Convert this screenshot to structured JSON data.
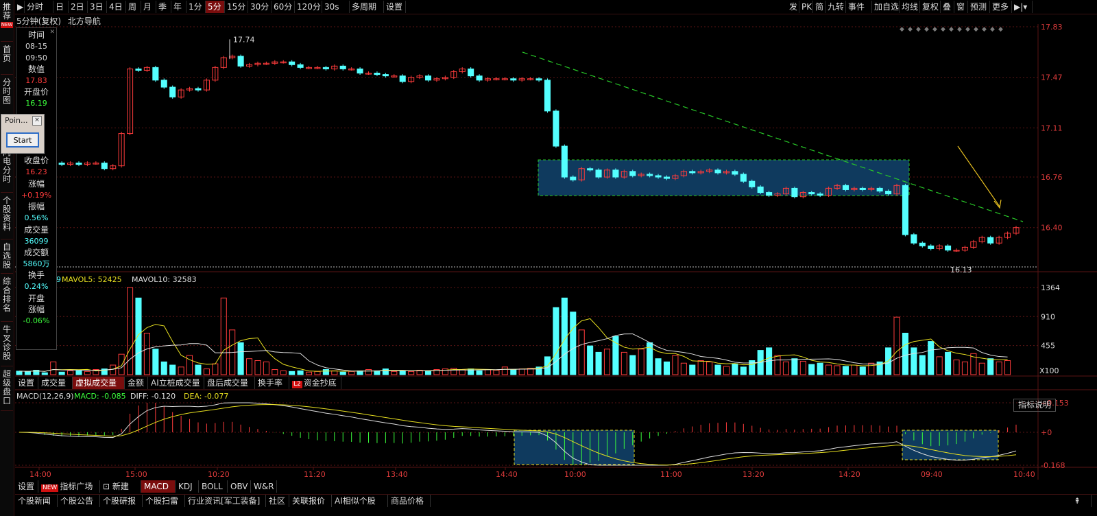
{
  "toolbar": {
    "items": [
      "分时",
      "日",
      "2日",
      "3日",
      "4日",
      "周",
      "月",
      "季",
      "年",
      "1分",
      "5分",
      "15分",
      "30分",
      "60分",
      "120分",
      "30s",
      "多周期",
      "设置"
    ],
    "active": "5分",
    "right_items": [
      "发",
      "PK",
      "简",
      "九转",
      "事件",
      "加自选",
      "均线",
      "复权",
      "叠",
      "窗",
      "预测",
      "更多"
    ]
  },
  "chart_header": {
    "period": "5分钟(复权)",
    "stock_name": "北方导航"
  },
  "left_nav": [
    {
      "text": "推荐",
      "badge": "NEW"
    },
    {
      "text": "首页"
    },
    {
      "text": "分时图"
    },
    {
      "text": "闪电分时"
    },
    {
      "text": "个股资料"
    },
    {
      "text": "自选股"
    },
    {
      "text": "综合排名"
    },
    {
      "text": "牛叉诊股"
    },
    {
      "text": "超级盘口"
    }
  ],
  "info_panel": {
    "time_label": "时间",
    "date": "08-15",
    "time": "09:50",
    "value_label": "数值",
    "value": "17.83",
    "open_label": "开盘价",
    "open": "16.19",
    "close_label": "收盘价",
    "close": "16.23",
    "chg_label": "涨幅",
    "chg": "+0.19%",
    "amp_label": "振幅",
    "amp": "0.56%",
    "vol_label": "成交量",
    "vol": "36099",
    "amt_label": "成交额",
    "amt": "5860万",
    "turn_label": "换手",
    "turn": "0.24%",
    "openchg_label1": "开盘",
    "openchg_label2": "涨幅",
    "openchg": "-0.06%"
  },
  "popup": {
    "title": "Poin...",
    "close": "×",
    "button": "Start"
  },
  "price_axis": [
    "17.83",
    "17.47",
    "17.11",
    "16.76",
    "16.40"
  ],
  "price_marks": {
    "high": "17.74",
    "low": "16.13"
  },
  "volume_header": {
    "mavol5_label": "MAVOL5: 52425",
    "mavol10_label": "MAVOL10: 32583",
    "prefix": "9"
  },
  "volume_axis": [
    "1364",
    "910",
    "455",
    "X100"
  ],
  "volume_tabs": [
    "设置",
    "成交量",
    "虚拟成交量",
    "金额",
    "AI立桩成交量",
    "盘后成交量",
    "换手率",
    "资金抄底"
  ],
  "volume_tab_active": "虚拟成交量",
  "volume_tab_badge": "L2",
  "macd_header": {
    "name": "MACD(12,26,9)",
    "macd": "MACD: -0.085",
    "diff": "DIFF: -0.120",
    "dea": "DEA: -0.077"
  },
  "macd_axis": [
    "+0.153",
    "+0",
    "-0.168"
  ],
  "macd_help": "指标说明",
  "time_axis": [
    "14:00",
    "15:00",
    "10:20",
    "11:20",
    "13:40",
    "14:40",
    "10:00",
    "11:00",
    "13:20",
    "14:20",
    "09:40",
    "10:40"
  ],
  "indicator_tabs": [
    "设置",
    "指标广场",
    "新建",
    "MACD",
    "KDJ",
    "BOLL",
    "OBV",
    "W&R"
  ],
  "indicator_tab_active": "MACD",
  "indicator_badge": "NEW",
  "bottom_tabs": [
    "个股新闻",
    "个股公告",
    "个股研报",
    "个股扫雷",
    "行业资讯[军工装备]",
    "社区",
    "关联报价",
    "AI相似个股",
    "商品价格"
  ],
  "colors": {
    "up": "#ff3c3c",
    "down": "#54ffff",
    "bg": "#000000",
    "grid": "#5a1414",
    "axis_text": "#e03c3c",
    "highlight": "#0f3a5e",
    "trend": "#28c828"
  },
  "chart_data": {
    "type": "candlestick",
    "price_range": [
      16.13,
      17.83
    ],
    "high": 17.74,
    "low": 16.13,
    "candles": [
      [
        16.95,
        16.94
      ],
      [
        16.94,
        16.93
      ],
      [
        16.93,
        16.9
      ],
      [
        16.9,
        16.86
      ],
      [
        16.86,
        16.86
      ],
      [
        16.86,
        16.85
      ],
      [
        16.85,
        16.86
      ],
      [
        16.86,
        16.85
      ],
      [
        16.85,
        16.86
      ],
      [
        16.86,
        16.86
      ],
      [
        16.86,
        16.82
      ],
      [
        16.82,
        16.84
      ],
      [
        16.84,
        17.07
      ],
      [
        17.07,
        17.53
      ],
      [
        17.53,
        17.52
      ],
      [
        17.52,
        17.54
      ],
      [
        17.54,
        17.45
      ],
      [
        17.45,
        17.4
      ],
      [
        17.4,
        17.33
      ],
      [
        17.33,
        17.38
      ],
      [
        17.38,
        17.39
      ],
      [
        17.39,
        17.38
      ],
      [
        17.38,
        17.45
      ],
      [
        17.45,
        17.54
      ],
      [
        17.54,
        17.61
      ],
      [
        17.61,
        17.62
      ],
      [
        17.62,
        17.55
      ],
      [
        17.55,
        17.56
      ],
      [
        17.56,
        17.57
      ],
      [
        17.57,
        17.57
      ],
      [
        17.57,
        17.58
      ],
      [
        17.58,
        17.58
      ],
      [
        17.58,
        17.56
      ],
      [
        17.56,
        17.54
      ],
      [
        17.54,
        17.54
      ],
      [
        17.54,
        17.54
      ],
      [
        17.54,
        17.53
      ],
      [
        17.53,
        17.55
      ],
      [
        17.55,
        17.53
      ],
      [
        17.53,
        17.53
      ],
      [
        17.53,
        17.5
      ],
      [
        17.5,
        17.5
      ],
      [
        17.5,
        17.49
      ],
      [
        17.49,
        17.48
      ],
      [
        17.48,
        17.48
      ],
      [
        17.48,
        17.44
      ],
      [
        17.44,
        17.47
      ],
      [
        17.47,
        17.48
      ],
      [
        17.48,
        17.45
      ],
      [
        17.45,
        17.46
      ],
      [
        17.46,
        17.47
      ],
      [
        17.47,
        17.51
      ],
      [
        17.51,
        17.53
      ],
      [
        17.53,
        17.48
      ],
      [
        17.48,
        17.45
      ],
      [
        17.45,
        17.46
      ],
      [
        17.46,
        17.46
      ],
      [
        17.46,
        17.46
      ],
      [
        17.46,
        17.45
      ],
      [
        17.45,
        17.46
      ],
      [
        17.46,
        17.46
      ],
      [
        17.46,
        17.45
      ],
      [
        17.45,
        17.23
      ],
      [
        17.23,
        16.98
      ],
      [
        16.98,
        16.76
      ],
      [
        16.76,
        16.74
      ],
      [
        16.74,
        16.82
      ],
      [
        16.82,
        16.81
      ],
      [
        16.81,
        16.76
      ],
      [
        16.76,
        16.81
      ],
      [
        16.81,
        16.76
      ],
      [
        16.76,
        16.8
      ],
      [
        16.8,
        16.77
      ],
      [
        16.77,
        16.78
      ],
      [
        16.78,
        16.77
      ],
      [
        16.77,
        16.76
      ],
      [
        16.76,
        16.75
      ],
      [
        16.75,
        16.77
      ],
      [
        16.77,
        16.8
      ],
      [
        16.8,
        16.79
      ],
      [
        16.79,
        16.8
      ],
      [
        16.8,
        16.81
      ],
      [
        16.81,
        16.79
      ],
      [
        16.79,
        16.8
      ],
      [
        16.8,
        16.78
      ],
      [
        16.78,
        16.73
      ],
      [
        16.73,
        16.69
      ],
      [
        16.69,
        16.65
      ],
      [
        16.65,
        16.63
      ],
      [
        16.63,
        16.64
      ],
      [
        16.64,
        16.68
      ],
      [
        16.68,
        16.62
      ],
      [
        16.62,
        16.65
      ],
      [
        16.65,
        16.64
      ],
      [
        16.64,
        16.63
      ],
      [
        16.63,
        16.68
      ],
      [
        16.68,
        16.7
      ],
      [
        16.7,
        16.67
      ],
      [
        16.67,
        16.68
      ],
      [
        16.68,
        16.67
      ],
      [
        16.67,
        16.68
      ],
      [
        16.68,
        16.66
      ],
      [
        16.66,
        16.64
      ],
      [
        16.64,
        16.7
      ],
      [
        16.7,
        16.35
      ],
      [
        16.35,
        16.29
      ],
      [
        16.29,
        16.27
      ],
      [
        16.27,
        16.25
      ],
      [
        16.25,
        16.27
      ],
      [
        16.27,
        16.24
      ],
      [
        16.24,
        16.24
      ],
      [
        16.24,
        16.26
      ],
      [
        16.26,
        16.3
      ],
      [
        16.3,
        16.33
      ],
      [
        16.33,
        16.29
      ],
      [
        16.29,
        16.33
      ],
      [
        16.33,
        16.36
      ],
      [
        16.36,
        16.4
      ]
    ],
    "volume": [
      55,
      50,
      70,
      30,
      200,
      40,
      60,
      60,
      50,
      80,
      90,
      150,
      320,
      1364,
      1200,
      650,
      400,
      200,
      150,
      120,
      300,
      150,
      90,
      170,
      1200,
      700,
      500,
      250,
      220,
      200,
      80,
      60,
      50,
      60,
      40,
      50,
      80,
      60,
      40,
      50,
      60,
      80,
      60,
      90,
      50,
      60,
      50,
      70,
      60,
      80,
      90,
      100,
      80,
      90,
      60,
      80,
      70,
      120,
      80,
      90,
      100,
      120,
      280,
      1050,
      1200,
      980,
      700,
      450,
      350,
      400,
      600,
      350,
      300,
      400,
      500,
      250,
      200,
      300,
      180,
      150,
      220,
      200,
      150,
      130,
      170,
      120,
      220,
      380,
      420,
      300,
      200,
      250,
      210,
      160,
      180,
      150,
      140,
      130,
      150,
      120,
      180,
      200,
      420,
      900,
      650,
      420,
      300,
      520,
      280,
      350,
      230,
      200,
      330,
      180,
      250,
      200,
      220
    ]
  }
}
